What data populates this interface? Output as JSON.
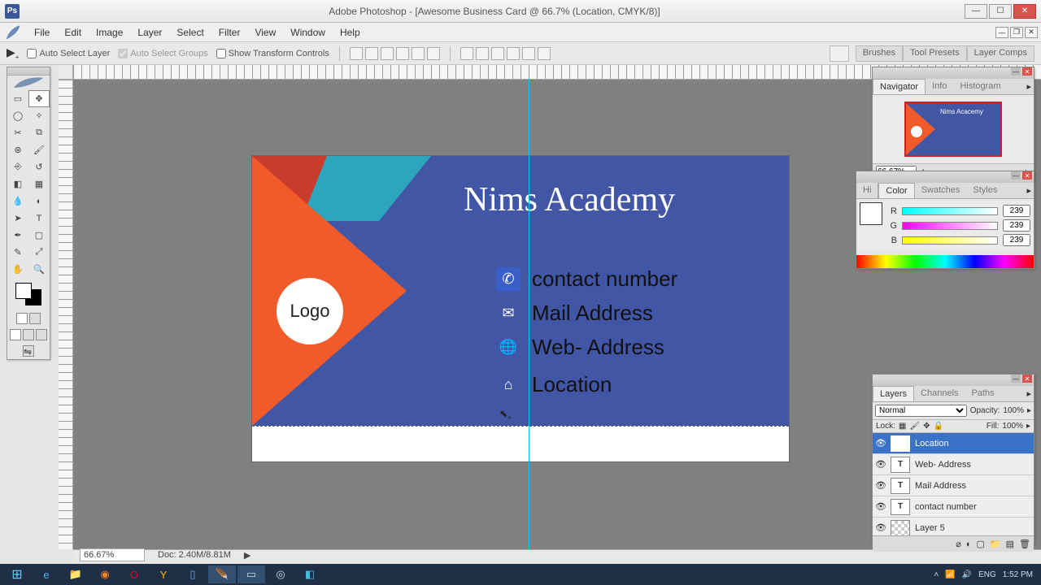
{
  "app": {
    "title": "Adobe Photoshop - [Awesome Business Card @ 66.7% (Location, CMYK/8)]"
  },
  "menu": [
    "File",
    "Edit",
    "Image",
    "Layer",
    "Select",
    "Filter",
    "View",
    "Window",
    "Help"
  ],
  "options": {
    "auto_select_layer": "Auto Select Layer",
    "auto_select_groups": "Auto Select Groups",
    "show_transform": "Show Transform Controls",
    "panel_tabs": [
      "Brushes",
      "Tool Presets",
      "Layer Comps"
    ]
  },
  "status": {
    "zoom": "66.67%",
    "doc": "Doc: 2.40M/8.81M"
  },
  "canvas": {
    "title": "Nims Academy",
    "logo": "Logo",
    "rows": [
      {
        "icon": "phone",
        "label": "contact number"
      },
      {
        "icon": "mail",
        "label": "Mail Address"
      },
      {
        "icon": "web",
        "label": "Web- Address"
      },
      {
        "icon": "home",
        "label": "Location"
      }
    ]
  },
  "navigator": {
    "tabs": [
      "Navigator",
      "Info",
      "Histogram"
    ],
    "zoom": "66.67%",
    "thumb_title": "Nims Acacemy"
  },
  "color": {
    "tabs": [
      "Color",
      "Swatches",
      "Styles"
    ],
    "side_tab": "Hi",
    "r": 239,
    "g": 239,
    "b": 239
  },
  "layers": {
    "tabs": [
      "Layers",
      "Channels",
      "Paths"
    ],
    "blend": "Normal",
    "opacity_label": "Opacity:",
    "opacity": "100%",
    "lock_label": "Lock:",
    "fill_label": "Fill:",
    "fill": "100%",
    "items": [
      {
        "type": "T",
        "name": "Location",
        "selected": true
      },
      {
        "type": "T",
        "name": "Web- Address"
      },
      {
        "type": "T",
        "name": "Mail Address"
      },
      {
        "type": "T",
        "name": "contact number"
      },
      {
        "type": "img",
        "name": "Layer 5"
      }
    ]
  },
  "taskbar": {
    "lang": "ENG",
    "time": "1:52 PM"
  }
}
